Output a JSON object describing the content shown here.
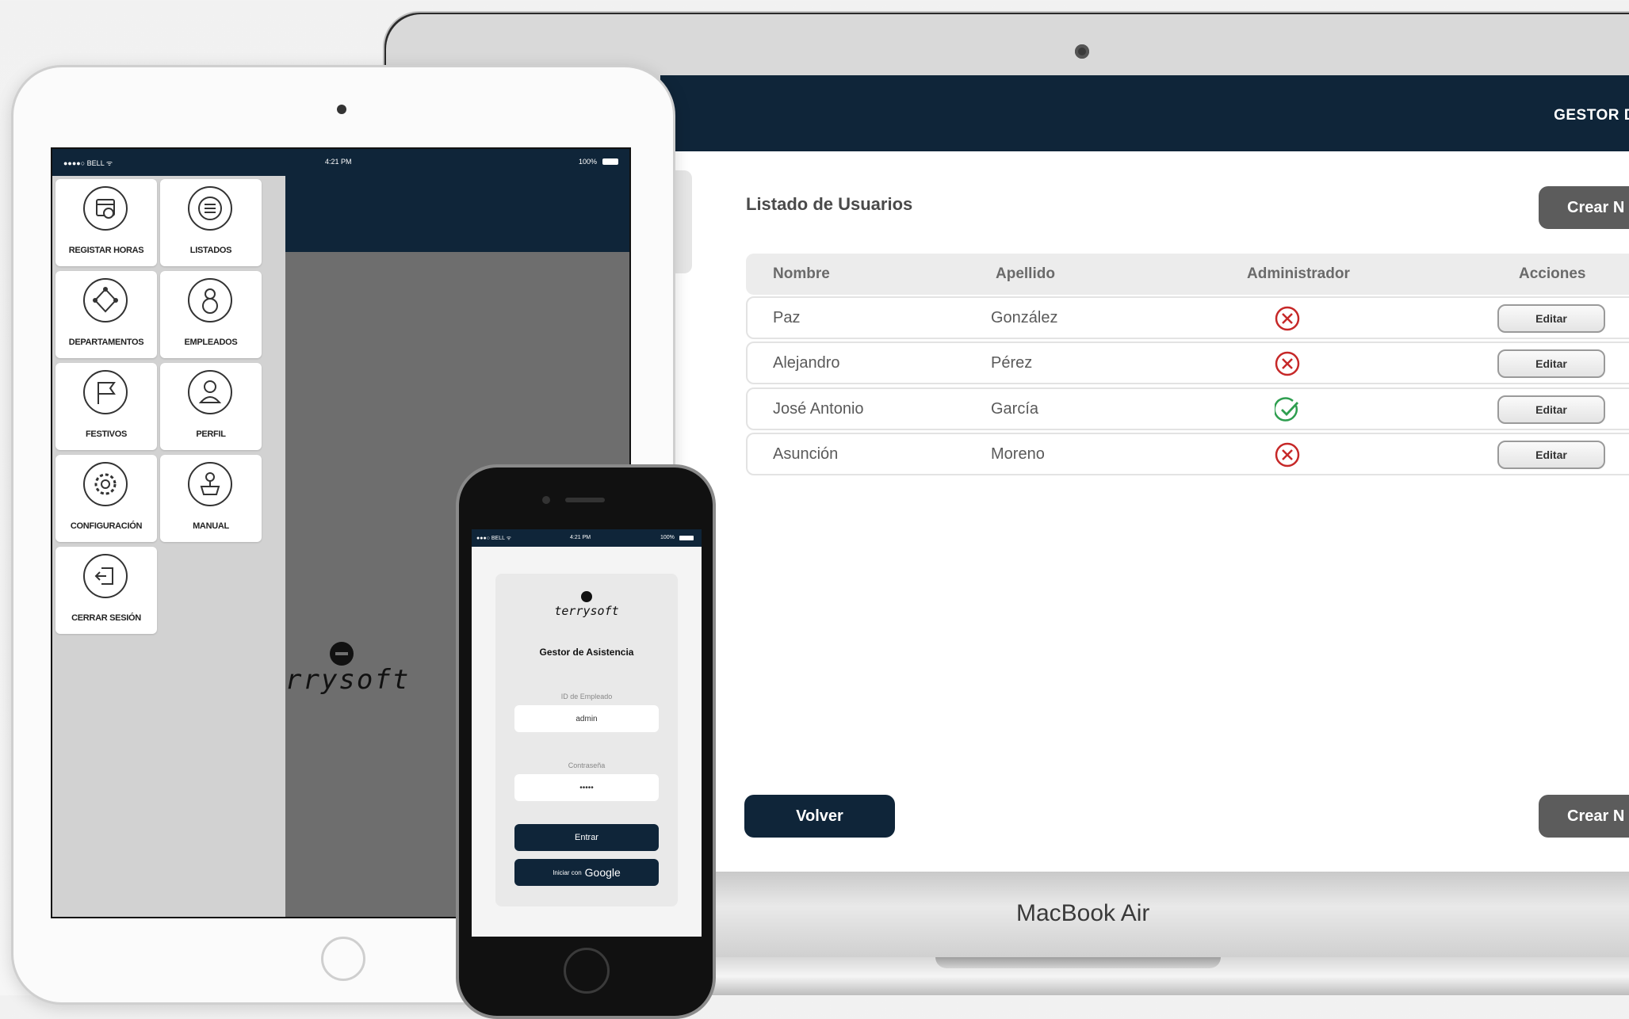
{
  "macbook": {
    "brand": "MacBook Air",
    "header_title": "GESTOR D",
    "list_title": "Listado de Usuarios",
    "create_button_label": "Crear N",
    "back_button_label": "Volver",
    "columns": [
      "Nombre",
      "Apellido",
      "Administrador",
      "Acciones"
    ],
    "rows": [
      {
        "nombre": "Paz",
        "apellido": "González",
        "admin": false,
        "action": "Editar"
      },
      {
        "nombre": "Alejandro",
        "apellido": "Pérez",
        "admin": false,
        "action": "Editar"
      },
      {
        "nombre": "José Antonio",
        "apellido": "García",
        "admin": true,
        "action": "Editar"
      },
      {
        "nombre": "Asunción",
        "apellido": "Moreno",
        "admin": false,
        "action": "Editar"
      }
    ],
    "colors": {
      "header": "#0f2539",
      "no": "#c62828",
      "yes": "#2e9e4f",
      "button_gray": "#5c5c5c"
    }
  },
  "ipad": {
    "status": {
      "carrier": "●●●●○ BELL ᯤ",
      "time": "4:21 PM",
      "battery": "100%"
    },
    "menu": [
      {
        "label": "REGISTAR HORAS",
        "icon": "calendar-clock-icon"
      },
      {
        "label": "LISTADOS",
        "icon": "list-icon"
      },
      {
        "label": "DEPARTAMENTOS",
        "icon": "network-icon"
      },
      {
        "label": "EMPLEADOS",
        "icon": "employees-icon"
      },
      {
        "label": "FESTIVOS",
        "icon": "flag-icon"
      },
      {
        "label": "PERFIL",
        "icon": "user-icon"
      },
      {
        "label": "CONFIGURACIÓN",
        "icon": "gear-icon"
      },
      {
        "label": "MANUAL",
        "icon": "manual-icon"
      },
      {
        "label": "CERRAR SESIÓN",
        "icon": "logout-icon"
      }
    ],
    "logo_text": "rrysoft"
  },
  "iphone": {
    "status": {
      "carrier": "●●●○ BELL ᯤ",
      "time": "4:21 PM",
      "battery": "100%"
    },
    "logo_text": "terrysoft",
    "app_title": "Gestor de Asistencia",
    "employee_label": "ID de Empleado",
    "employee_value": "admin",
    "password_label": "Contraseña",
    "password_value": "•••••",
    "enter_label": "Entrar",
    "google_prefix": "Iniciar con",
    "google_label": "Google"
  }
}
